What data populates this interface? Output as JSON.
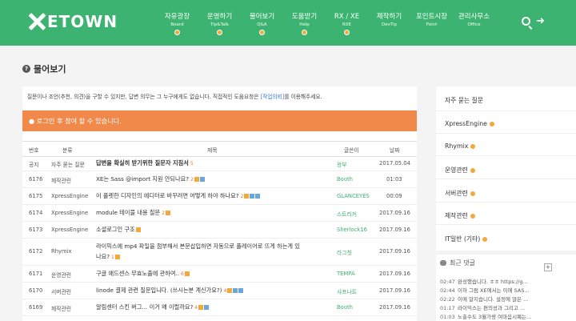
{
  "header": {
    "logo": "ETOWN",
    "nav": [
      {
        "title": "자유광장",
        "sub": "Board"
      },
      {
        "title": "운영하기",
        "sub": "Tip&Talk"
      },
      {
        "title": "물어보기",
        "sub": "Q&A"
      },
      {
        "title": "도움받기",
        "sub": "Help"
      },
      {
        "title": "RX / XE",
        "sub": "RXE"
      },
      {
        "title": "제작하기",
        "sub": "DevTip"
      },
      {
        "title": "포인트시장",
        "sub": "Point"
      },
      {
        "title": "관리사무소",
        "sub": "Office"
      }
    ]
  },
  "page": {
    "title": "물어보기",
    "desc_prefix": "질문이나 조언(추천, 의견)을 구할 수 있지만, 답변 의무는 그 누구에게도 없습니다. 직접적인 도움요청은 ",
    "desc_link": "[작업의뢰]",
    "desc_suffix": "를 이용해주세요.",
    "alert": "로그인 후 참여 할 수 있습니다."
  },
  "table": {
    "headers": {
      "no": "번호",
      "category": "분류",
      "title": "제목",
      "author": "글쓴이",
      "date": "날짜"
    },
    "rows": [
      {
        "no": "공지",
        "category": "자주 묻는 질문",
        "title": "답변을 확실히 받기위한 질문자 지침서",
        "count": "5",
        "author": "왕부",
        "date": "2017.05.04",
        "bold": true
      },
      {
        "no": "6176",
        "category": "제작관련",
        "title": "XE는 Sass @import 지원 안되나요?",
        "count": "2",
        "author": "Booth",
        "date": "01:03"
      },
      {
        "no": "6175",
        "category": "XpressEngine",
        "title": "이 플렛한 디자인의 에디터로 바꾸려면 어떻게 하야 하나요?",
        "count": "2",
        "author": "GLANCEYES",
        "date": "00:09"
      },
      {
        "no": "6174",
        "category": "XpressEngine",
        "title": "module 테이블 내용 질문",
        "count": "2",
        "author": "스트리커",
        "date": "2017.09.16"
      },
      {
        "no": "6173",
        "category": "XpressEngine",
        "title": "소셜로그인 구조",
        "count": "",
        "author": "Sherlock16",
        "date": "2017.09.16"
      },
      {
        "no": "6172",
        "category": "Rhymix",
        "title": "라이믹스에 mp4 파일을 첨부해서 본문삽입하면 자동으로 플레이어로 뜨게 하는게 있나요?",
        "title1": "라이믹스에 mp4 파일을 첨부해서 본문삽입하면 자동으로 플레이어로 뜨게 하는게 있",
        "title2": "나요?",
        "count": "1",
        "author": "라그칫",
        "date": "2017.09.16"
      },
      {
        "no": "6171",
        "category": "운영관련",
        "title": "구글 애드센스 무효노출에 관하여..",
        "count": "6",
        "author": "TEMPA",
        "date": "2017.09.16"
      },
      {
        "no": "6170",
        "category": "서버관련",
        "title": "linode 결제 관련 질문입니다. (쓰시는분 계신가요?)",
        "count": "4",
        "author": "샤프나트",
        "date": "2017.09.16"
      },
      {
        "no": "6169",
        "category": "제작관련",
        "title": "알림센터 스킨 버그... 이거 왜 이럴까요?",
        "count": "4",
        "author": "Booth",
        "date": "2017.09.16"
      }
    ]
  },
  "sidebar": {
    "items": [
      "자주 묻는 질문",
      "XpressEngine",
      "Rhymix",
      "운영관련",
      "서버관련",
      "제작관련",
      "IT일반 (기타)"
    ]
  },
  "recent": {
    "title": "최근 댓글",
    "items": [
      {
        "time": "02:47",
        "text": "완성했습니다. ㅎㅎ https://g..."
      },
      {
        "time": "02:44",
        "text": "이하 그럼 XE에서는 이에 SAS..."
      },
      {
        "time": "02:22",
        "text": "이에 알지습니다. 설정에 많은 ..."
      },
      {
        "time": "01:17",
        "text": "라이믹스는 편의성과 그리고 ..."
      },
      {
        "time": "01:03",
        "text": "노출수도 3월가량 여마음시폐는..."
      }
    ]
  },
  "colors": {
    "brand": "#3cb371",
    "alert": "#f0894a",
    "badge": "#f2a93b"
  }
}
